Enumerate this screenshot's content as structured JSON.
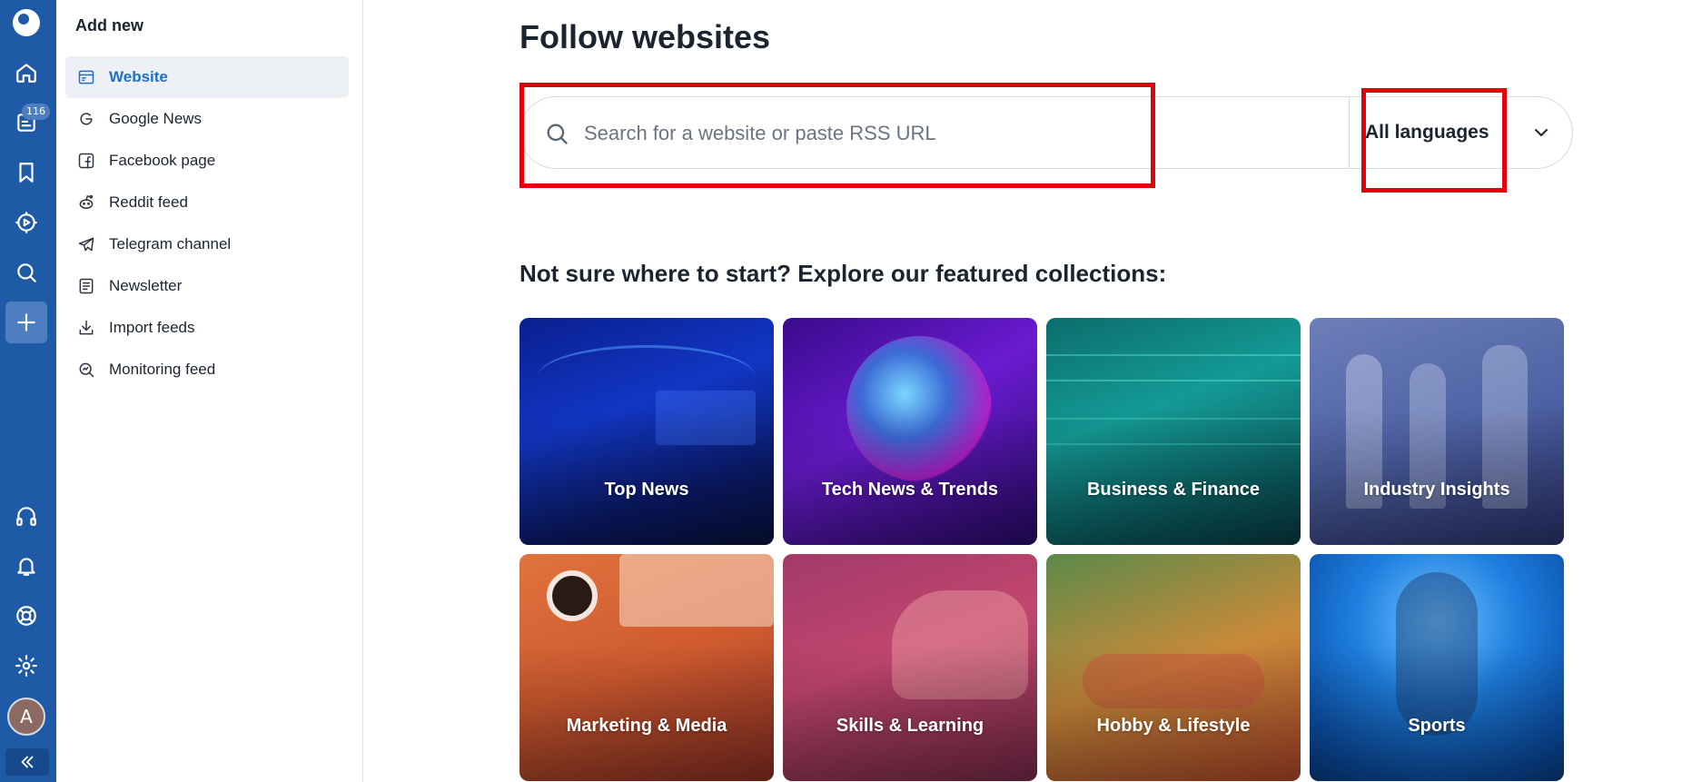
{
  "rail": {
    "badge_count": "116",
    "avatar_letter": "A",
    "icons": [
      "logo-icon",
      "home-icon",
      "feeds-icon",
      "bookmark-icon",
      "play-icon",
      "search-icon",
      "add-icon",
      "headset-icon",
      "bell-icon",
      "help-icon",
      "settings-icon",
      "collapse-icon"
    ]
  },
  "sidebar": {
    "title": "Add new",
    "items": [
      {
        "label": "Website",
        "icon": "website-icon",
        "active": true
      },
      {
        "label": "Google News",
        "icon": "google-icon"
      },
      {
        "label": "Facebook page",
        "icon": "facebook-icon"
      },
      {
        "label": "Reddit feed",
        "icon": "reddit-icon"
      },
      {
        "label": "Telegram channel",
        "icon": "telegram-icon"
      },
      {
        "label": "Newsletter",
        "icon": "newsletter-icon"
      },
      {
        "label": "Import feeds",
        "icon": "import-icon"
      },
      {
        "label": "Monitoring feed",
        "icon": "monitoring-icon"
      }
    ]
  },
  "main": {
    "title": "Follow websites",
    "search": {
      "placeholder": "Search for a website or paste RSS URL",
      "value": ""
    },
    "language": {
      "selected": "All languages"
    },
    "collections_title": "Not sure where to start? Explore our featured collections:",
    "collections": [
      {
        "label": "Top News"
      },
      {
        "label": "Tech News & Trends"
      },
      {
        "label": "Business & Finance"
      },
      {
        "label": "Industry Insights"
      },
      {
        "label": "Marketing & Media"
      },
      {
        "label": "Skills & Learning"
      },
      {
        "label": "Hobby & Lifestyle"
      },
      {
        "label": "Sports"
      }
    ]
  },
  "colors": {
    "rail": "#1f5aa6",
    "accent": "#1f6fc9",
    "highlight": "#e4000b"
  }
}
